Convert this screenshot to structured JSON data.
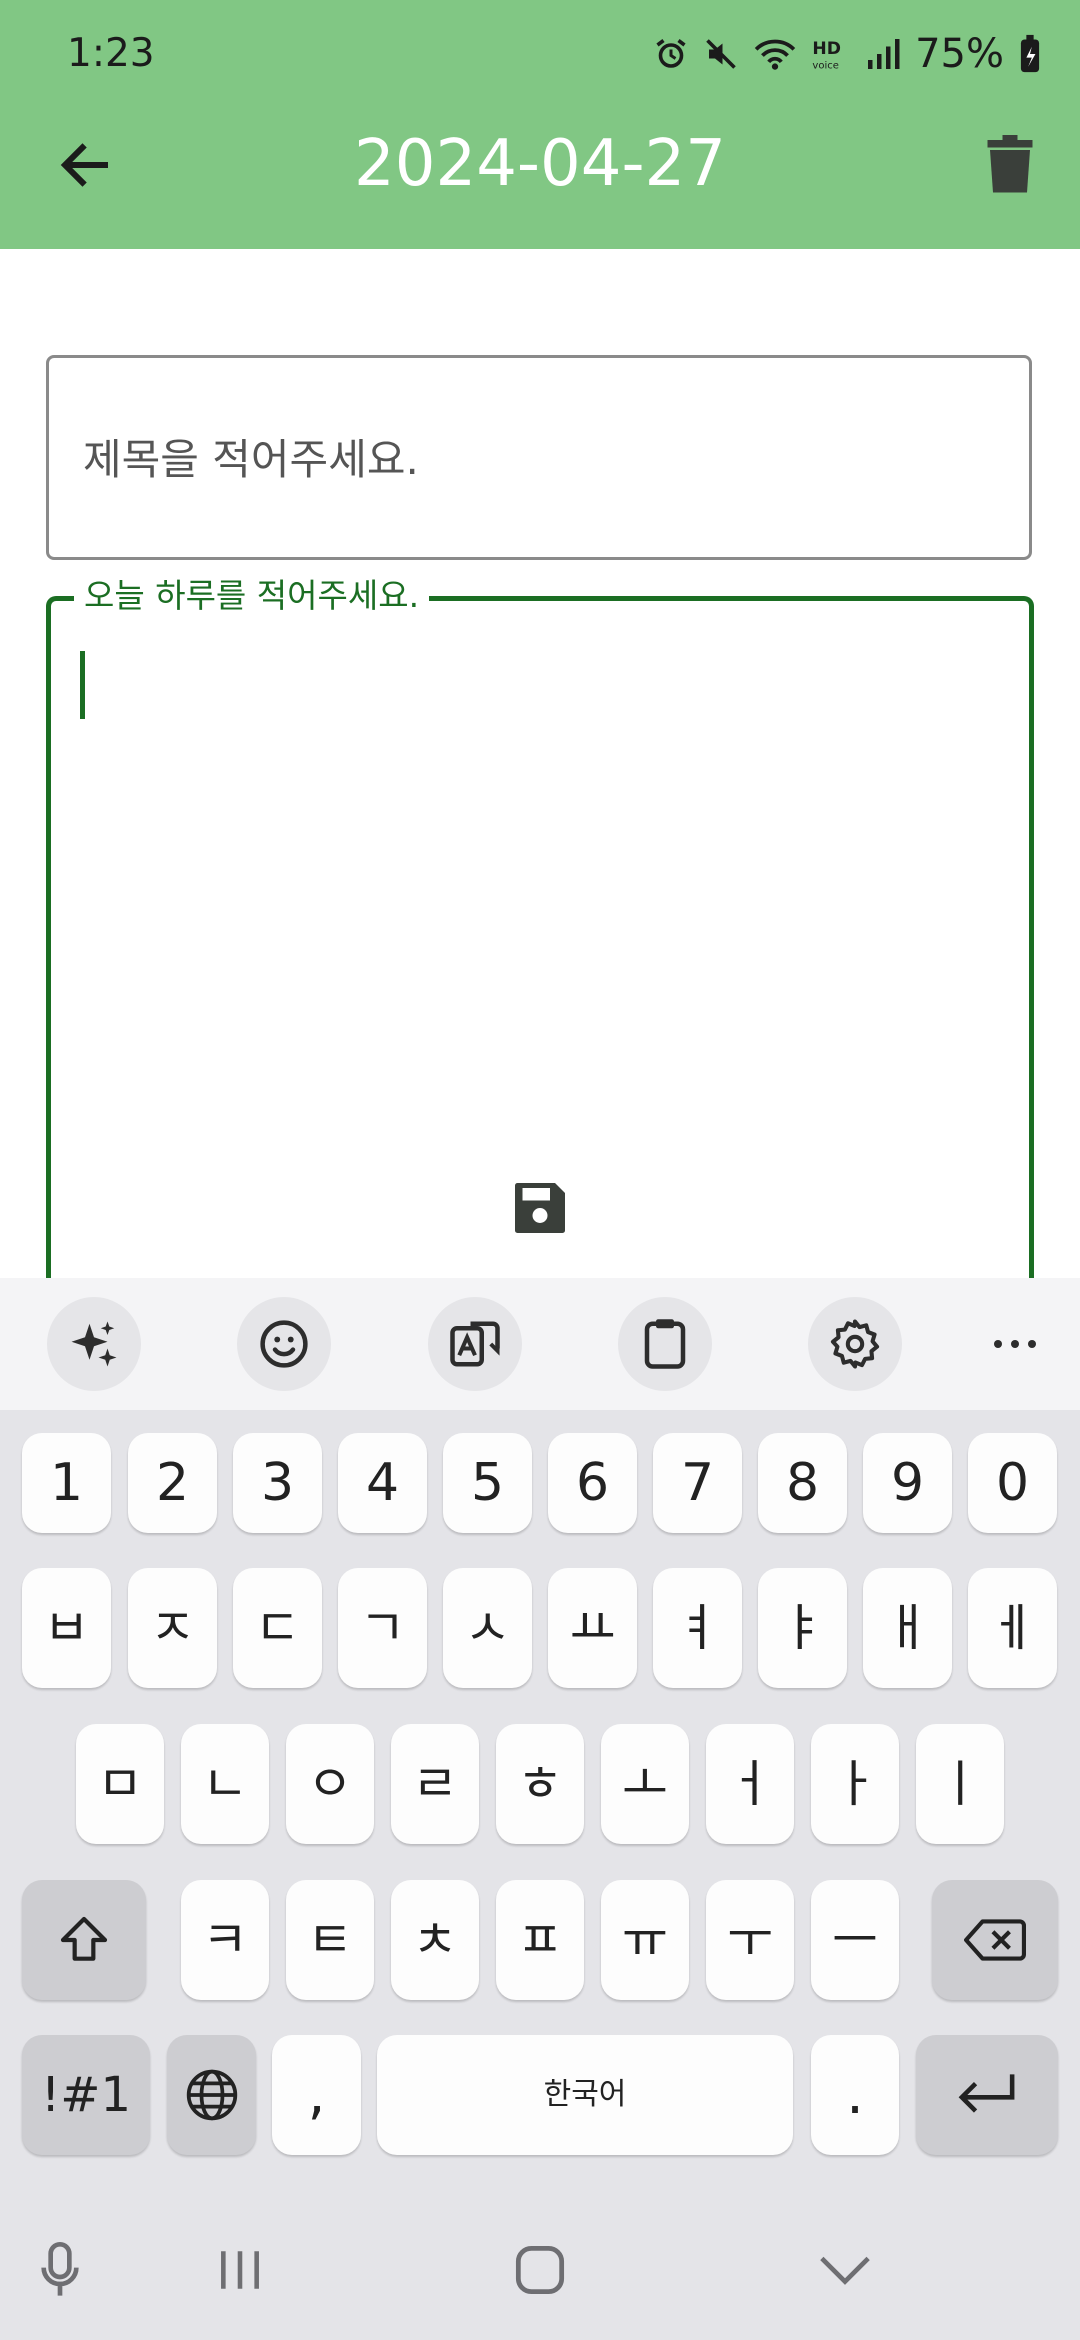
{
  "status_bar": {
    "time": "1:23",
    "battery_percent": "75%",
    "icons": [
      "alarm-icon",
      "mute-icon",
      "wifi-icon",
      "hd-voice-icon",
      "signal-icon",
      "battery-charging-icon"
    ]
  },
  "app_bar": {
    "title": "2024-04-27",
    "back_icon": "arrow-back-icon",
    "delete_icon": "trash-icon",
    "background": "#81c784"
  },
  "form": {
    "title_placeholder": "제목을 적어주세요.",
    "title_value": "",
    "body_label": "오늘 하루를 적어주세요.",
    "body_value": "",
    "accent_color": "#1b6e23",
    "save_icon": "save-icon"
  },
  "keyboard": {
    "toolbar": [
      "ai-sparkle-icon",
      "emoji-icon",
      "translate-icon",
      "clipboard-icon",
      "settings-icon",
      "more-icon"
    ],
    "number_row": [
      "1",
      "2",
      "3",
      "4",
      "5",
      "6",
      "7",
      "8",
      "9",
      "0"
    ],
    "row1": [
      "ㅂ",
      "ㅈ",
      "ㄷ",
      "ㄱ",
      "ㅅ",
      "ㅛ",
      "ㅕ",
      "ㅑ",
      "ㅐ",
      "ㅔ"
    ],
    "row2": [
      "ㅁ",
      "ㄴ",
      "ㅇ",
      "ㄹ",
      "ㅎ",
      "ㅗ",
      "ㅓ",
      "ㅏ",
      "ㅣ"
    ],
    "row3": [
      "ㅋ",
      "ㅌ",
      "ㅊ",
      "ㅍ",
      "ㅠ",
      "ㅜ",
      "ㅡ"
    ],
    "symbols_label": "!#1",
    "comma_label": ",",
    "space_label": "한국어",
    "period_label": "."
  },
  "nav_bar": {
    "icons": [
      "mic-icon",
      "recents-icon",
      "home-icon",
      "hide-keyboard-icon"
    ]
  }
}
